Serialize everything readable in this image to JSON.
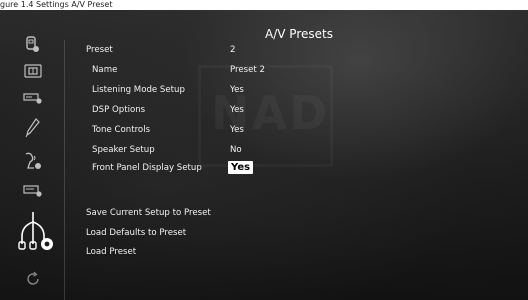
{
  "caption": "gure 1.4 Settings A/V Preset",
  "screen": {
    "title": "A/V Presets",
    "watermark": "NAD"
  },
  "settings": [
    {
      "label": "Preset",
      "value": "2",
      "indent": false,
      "selected": false
    },
    {
      "label": "Name",
      "value": "Preset 2",
      "indent": true,
      "selected": false
    },
    {
      "label": "Listening Mode Setup",
      "value": "Yes",
      "indent": true,
      "selected": false
    },
    {
      "label": "DSP Options",
      "value": "Yes",
      "indent": true,
      "selected": false
    },
    {
      "label": "Tone Controls",
      "value": "Yes",
      "indent": true,
      "selected": false
    },
    {
      "label": "Speaker Setup",
      "value": "No",
      "indent": true,
      "selected": false
    },
    {
      "label": "Front Panel Display Setup",
      "value": "Yes",
      "indent": true,
      "selected": true
    }
  ],
  "actions": [
    "Save Current Setup to Preset",
    "Load Defaults to Preset",
    "Load Preset"
  ],
  "sidebar": {
    "icons": [
      "source-settings-icon",
      "amplifier-icon",
      "display-settings-icon",
      "pen-icon",
      "speaker-settings-icon",
      "zone-settings-icon",
      "av-presets-icon",
      "refresh-icon"
    ],
    "active_index": 6
  },
  "colors": {
    "text": "#f2f2f2",
    "selected_bg": "#ffffff",
    "selected_text": "#000000",
    "icon": "#bfbfbf"
  }
}
